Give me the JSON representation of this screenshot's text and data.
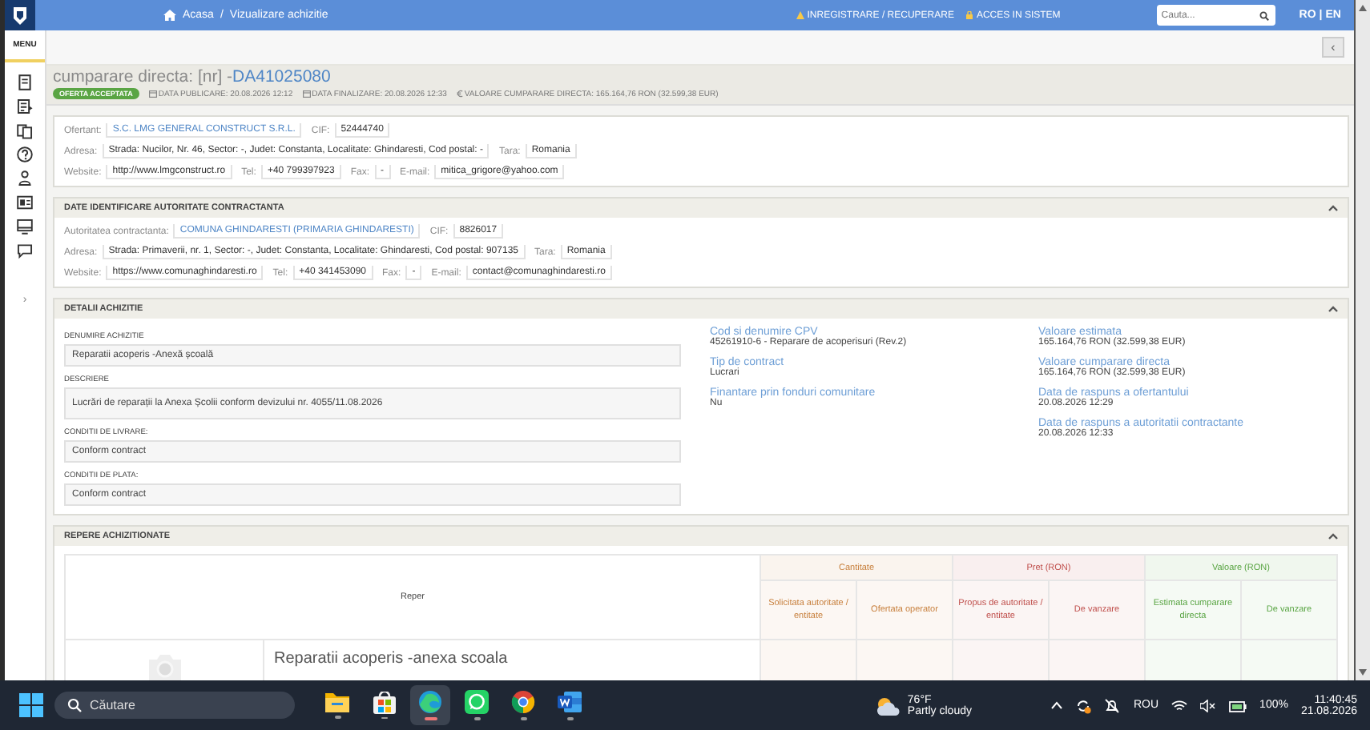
{
  "topbar": {
    "breadcrumb": [
      "Acasa",
      "Vizualizare achizitie"
    ],
    "breadcrumb_separator": "/",
    "links": [
      {
        "kind": "warning",
        "label": "INREGISTRARE / RECUPERARE"
      },
      {
        "kind": "lock",
        "label": "ACCES IN SISTEM"
      }
    ],
    "search": {
      "placeholder": "Cauta..."
    },
    "languages": [
      "RO",
      "EN"
    ],
    "language_separator": "|"
  },
  "sidebar": {
    "menu_label": "MENU",
    "toggle": "›"
  },
  "collapse_button": "‹",
  "header": {
    "title": "cumparare directa: [nr] - ",
    "code": "DA41025080",
    "status": "OFERTA ACCEPTATA",
    "meta": [
      {
        "kind": "calendar",
        "text": "DATA PUBLICARE: 20.08.2026 12:12"
      },
      {
        "kind": "calendar",
        "text": "DATA FINALIZARE: 20.08.2026 12:33"
      },
      {
        "kind": "euro",
        "text": "VALOARE CUMPARARE DIRECTA: 165.164,76  RON (32.599,38  EUR)"
      }
    ]
  },
  "offertant": {
    "lines": [
      {
        "fields": [
          {
            "label": "Ofertant:",
            "value": "S.C. LMG GENERAL CONSTRUCT S.R.L.",
            "link": true
          },
          {
            "label": "CIF:",
            "value": "52444740",
            "link": false
          }
        ]
      },
      {
        "fields": [
          {
            "label": "Adresa:",
            "value": "Strada: Nucilor, Nr. 46, Sector: -, Judet: Constanta, Localitate: Ghindaresti, Cod postal: -",
            "link": false
          },
          {
            "label": "Tara:",
            "value": "Romania",
            "link": false
          }
        ]
      },
      {
        "fields": [
          {
            "label": "Website:",
            "value": "http://www.lmgconstruct.ro",
            "link": false
          },
          {
            "label": "Tel:",
            "value": "+40 799397923",
            "link": false
          },
          {
            "label": "Fax:",
            "value": "-",
            "link": false
          },
          {
            "label": "E-mail:",
            "value": "mitica_grigore@yahoo.com",
            "link": false
          }
        ]
      }
    ]
  },
  "autoritate": {
    "title": "DATE IDENTIFICARE AUTORITATE CONTRACTANTA",
    "lines": [
      {
        "fields": [
          {
            "label": "Autoritatea contractanta:",
            "value": "COMUNA GHINDARESTI (PRIMARIA GHINDARESTI)",
            "link": true
          },
          {
            "label": "CIF:",
            "value": "8826017",
            "link": false
          }
        ]
      },
      {
        "fields": [
          {
            "label": "Adresa:",
            "value": "Strada: Primaverii, nr. 1, Sector: -, Judet: Constanta, Localitate: Ghindaresti, Cod postal: 907135",
            "link": false
          },
          {
            "label": "Tara:",
            "value": "Romania",
            "link": false
          }
        ]
      },
      {
        "fields": [
          {
            "label": "Website:",
            "value": "https://www.comunaghindaresti.ro",
            "link": false
          },
          {
            "label": "Tel:",
            "value": "+40 341453090",
            "link": false
          },
          {
            "label": "Fax:",
            "value": "-",
            "link": false
          },
          {
            "label": "E-mail:",
            "value": "contact@comunaghindaresti.ro",
            "link": false
          }
        ]
      }
    ]
  },
  "detalii": {
    "title": "DETALII ACHIZITIE",
    "fields": [
      {
        "label": "DENUMIRE ACHIZITIE",
        "value": "Reparatii acoperis -Anexă școală"
      },
      {
        "label": "DESCRIERE",
        "value": "Lucrări de reparații la Anexa Școlii conform devizului nr. 4055/11.08.2026"
      },
      {
        "label": "CONDITII DE LIVRARE:",
        "value": "Conform contract"
      },
      {
        "label": "CONDITII DE PLATA:",
        "value": "Conform contract"
      }
    ],
    "info_left": [
      {
        "label": "Cod si denumire CPV",
        "value": "45261910-6 - Reparare de acoperisuri (Rev.2)"
      },
      {
        "label": "Tip de contract",
        "value": "Lucrari"
      },
      {
        "label": "Finantare prin fonduri comunitare",
        "value": "Nu"
      }
    ],
    "info_right": [
      {
        "label": "Valoare estimata",
        "value": "165.164,76  RON (32.599,38  EUR)"
      },
      {
        "label": "Valoare cumparare directa",
        "value": "165.164,76  RON (32.599,38  EUR)"
      },
      {
        "label": "Data de raspuns a ofertantului",
        "value": "20.08.2026 12:29"
      },
      {
        "label": "Data de raspuns a autoritatii contractante",
        "value": "20.08.2026 12:33"
      }
    ]
  },
  "repere": {
    "title": "REPERE ACHIZITIONATE",
    "first_column": "Reper",
    "groups": [
      {
        "label": "Cantitate",
        "color": "#c8813f",
        "columns": [
          "Solicitata autoritate / entitate",
          "Ofertata operator"
        ]
      },
      {
        "label": "Pret (RON)",
        "color": "#c0504d",
        "columns": [
          "Propus de autoritate / entitate",
          "De vanzare"
        ]
      },
      {
        "label": "Valoare (RON)",
        "color": "#5aa544",
        "columns": [
          "Estimata cumparare directa",
          "De vanzare"
        ]
      }
    ],
    "rows": [
      {
        "name": "Reparatii acoperis -anexa scoala"
      }
    ]
  },
  "taskbar": {
    "search": {
      "placeholder": "Căutare"
    },
    "apps": [
      {
        "kind": "folder",
        "selected": false
      },
      {
        "kind": "store",
        "selected": false
      },
      {
        "kind": "edge",
        "selected": true
      },
      {
        "kind": "whatsapp",
        "selected": false
      },
      {
        "kind": "chrome",
        "selected": false
      },
      {
        "kind": "word",
        "selected": false
      }
    ],
    "weather": {
      "temperature": "76°F",
      "condition": "Partly cloudy"
    },
    "language": "ROU",
    "battery": "100%",
    "time": "11:40:45",
    "date": "21.08.2026"
  }
}
